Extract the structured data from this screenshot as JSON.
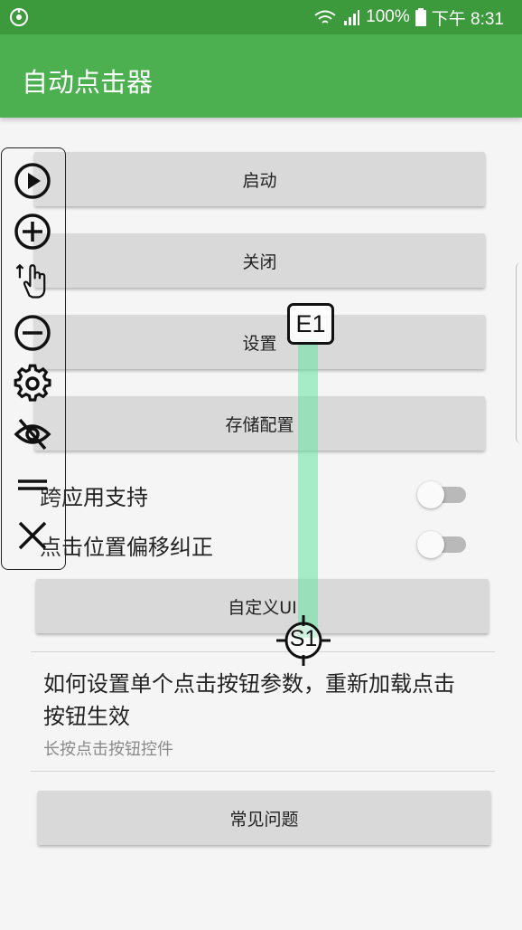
{
  "status_bar": {
    "battery": "100%",
    "time": "下午 8:31",
    "icons": [
      "app-status-icon",
      "wifi-icon",
      "signal-icon",
      "battery-icon"
    ]
  },
  "app_bar": {
    "title": "自动点击器"
  },
  "buttons": {
    "start": "启动",
    "close": "关闭",
    "settings": "设置",
    "save_config": "存储配置",
    "custom_ui": "自定义UI",
    "faq": "常见问题"
  },
  "settings": [
    {
      "label": "跨应用支持",
      "enabled": false
    },
    {
      "label": "点击位置偏移纠正",
      "enabled": false
    }
  ],
  "help": {
    "title": "如何设置单个点击按钮参数，重新加载点击按钮生效",
    "subtitle": "长按点击按钮控件"
  },
  "markers": {
    "end_label": "E1",
    "start_label": "S1"
  },
  "floating_toolbar": {
    "icons": [
      "play-icon",
      "add-icon",
      "swipe-gesture-icon",
      "remove-icon",
      "settings-gear-icon",
      "hide-eye-icon",
      "drag-handle-icon",
      "close-icon"
    ]
  },
  "colors": {
    "status_bar": "#3c9a3c",
    "app_bar": "#4caf50",
    "swipe_line": "#64e6a0"
  }
}
